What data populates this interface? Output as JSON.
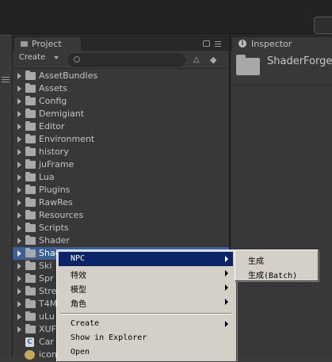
{
  "project_panel": {
    "tab_label": "Project",
    "create_label": "Create",
    "search_placeholder": "",
    "icons": [
      "folder-icon",
      "lock-icon",
      "menu-icon",
      "search-icon",
      "filter-by-type-icon",
      "filter-by-label-icon"
    ]
  },
  "tree_items": [
    {
      "label": "AssetBundles"
    },
    {
      "label": "Assets"
    },
    {
      "label": "Config"
    },
    {
      "label": "Demigiant"
    },
    {
      "label": "Editor"
    },
    {
      "label": "Environment"
    },
    {
      "label": "history"
    },
    {
      "label": "juFrame"
    },
    {
      "label": "Lua"
    },
    {
      "label": "Plugins"
    },
    {
      "label": "RawRes"
    },
    {
      "label": "Resources"
    },
    {
      "label": "Scripts"
    },
    {
      "label": "Shader"
    },
    {
      "label": "Shad"
    },
    {
      "label": "Ski"
    },
    {
      "label": "Spr"
    },
    {
      "label": "Stre"
    },
    {
      "label": "T4M"
    },
    {
      "label": "uLu"
    },
    {
      "label": "XUF"
    },
    {
      "label": "Car"
    },
    {
      "label": "icon"
    }
  ],
  "inspector": {
    "tab_label": "Inspector",
    "title": "ShaderForge"
  },
  "context_menu": {
    "items": [
      {
        "label": "NPC",
        "submenu": true,
        "highlighted": true
      },
      {
        "label": "特效",
        "submenu": true
      },
      {
        "label": "模型",
        "submenu": true
      },
      {
        "label": "角色",
        "submenu": true
      },
      {
        "label": "Create",
        "submenu": true
      },
      {
        "label": "Show in Explorer"
      },
      {
        "label": "Open"
      }
    ]
  },
  "submenu": {
    "items": [
      {
        "label": "生成"
      },
      {
        "label": "生成(Batch)"
      }
    ]
  },
  "colors": {
    "selection": "#3e5f96",
    "menu_highlight": "#0a246a",
    "menu_bg": "#d4d0c8",
    "panel_bg": "#383838"
  }
}
